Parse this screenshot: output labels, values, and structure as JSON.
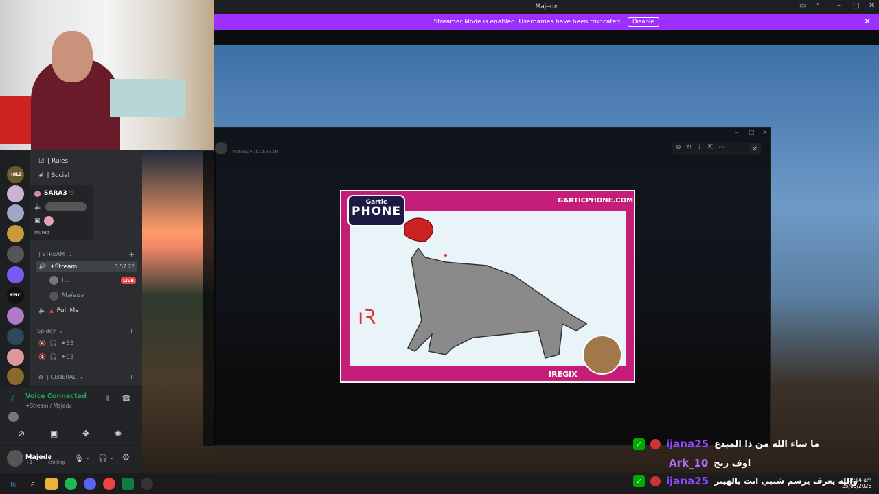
{
  "window": {
    "title": "Majedꫀ"
  },
  "banner": {
    "text": "Streamer Mode is enabled. Usernames have been truncated.",
    "button": "Disable"
  },
  "popup": {
    "timestamp": "Yesterday at 12:26 AM"
  },
  "gartic": {
    "logo_top": "Gartic",
    "logo_main": "PHONE",
    "url": "GARTICPHONE.COM",
    "artist": "IREGIX"
  },
  "channels": {
    "rules": "| Rules",
    "social": "| Social",
    "stream_category": "| STREAM",
    "stream_channel": "✦Stream",
    "stream_timer": "3:57:22",
    "member1": "I...",
    "member1_badge": "LIVE",
    "member2": "Majedꫀ",
    "pull_me": "Pull Me",
    "spidey_category": "Spidey",
    "ch33": "✦33",
    "ch03": "✦03",
    "general_category": "| GENERAL"
  },
  "popover": {
    "name": "SARA3 ♡",
    "status": "Muted"
  },
  "voice": {
    "status": "Voice Connected",
    "location": "✦Stream / Majedꫀ"
  },
  "user": {
    "name": "Majedꫀ",
    "status": "chilling",
    "indicator": "+1"
  },
  "chat": [
    {
      "user": "ijana25",
      "message": "ما شاء الله من ذا المبدع",
      "color": "#9146ff"
    },
    {
      "user": "Ark_10",
      "message": "اوف ريج",
      "color": "#b26bff"
    },
    {
      "user": "ijana25",
      "message": "والله يعرف يرسم شتبي انت يالهيتر",
      "color": "#9146ff"
    }
  ],
  "clock": {
    "time": "12:14 am",
    "date": "25/03/2026"
  },
  "colors": {
    "banner": "#9b30ff",
    "discord_bg": "#2b2d31",
    "gartic_pink": "#c51e78",
    "voice_green": "#23a55a"
  }
}
